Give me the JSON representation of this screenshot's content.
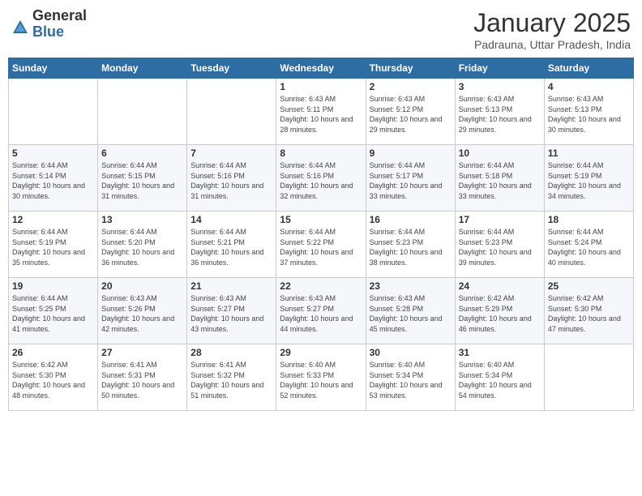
{
  "logo": {
    "general": "General",
    "blue": "Blue"
  },
  "header": {
    "month": "January 2025",
    "location": "Padrauna, Uttar Pradesh, India"
  },
  "days_of_week": [
    "Sunday",
    "Monday",
    "Tuesday",
    "Wednesday",
    "Thursday",
    "Friday",
    "Saturday"
  ],
  "weeks": [
    [
      {
        "day": "",
        "info": ""
      },
      {
        "day": "",
        "info": ""
      },
      {
        "day": "",
        "info": ""
      },
      {
        "day": "1",
        "info": "Sunrise: 6:43 AM\nSunset: 5:11 PM\nDaylight: 10 hours and 28 minutes."
      },
      {
        "day": "2",
        "info": "Sunrise: 6:43 AM\nSunset: 5:12 PM\nDaylight: 10 hours and 29 minutes."
      },
      {
        "day": "3",
        "info": "Sunrise: 6:43 AM\nSunset: 5:13 PM\nDaylight: 10 hours and 29 minutes."
      },
      {
        "day": "4",
        "info": "Sunrise: 6:43 AM\nSunset: 5:13 PM\nDaylight: 10 hours and 30 minutes."
      }
    ],
    [
      {
        "day": "5",
        "info": "Sunrise: 6:44 AM\nSunset: 5:14 PM\nDaylight: 10 hours and 30 minutes."
      },
      {
        "day": "6",
        "info": "Sunrise: 6:44 AM\nSunset: 5:15 PM\nDaylight: 10 hours and 31 minutes."
      },
      {
        "day": "7",
        "info": "Sunrise: 6:44 AM\nSunset: 5:16 PM\nDaylight: 10 hours and 31 minutes."
      },
      {
        "day": "8",
        "info": "Sunrise: 6:44 AM\nSunset: 5:16 PM\nDaylight: 10 hours and 32 minutes."
      },
      {
        "day": "9",
        "info": "Sunrise: 6:44 AM\nSunset: 5:17 PM\nDaylight: 10 hours and 33 minutes."
      },
      {
        "day": "10",
        "info": "Sunrise: 6:44 AM\nSunset: 5:18 PM\nDaylight: 10 hours and 33 minutes."
      },
      {
        "day": "11",
        "info": "Sunrise: 6:44 AM\nSunset: 5:19 PM\nDaylight: 10 hours and 34 minutes."
      }
    ],
    [
      {
        "day": "12",
        "info": "Sunrise: 6:44 AM\nSunset: 5:19 PM\nDaylight: 10 hours and 35 minutes."
      },
      {
        "day": "13",
        "info": "Sunrise: 6:44 AM\nSunset: 5:20 PM\nDaylight: 10 hours and 36 minutes."
      },
      {
        "day": "14",
        "info": "Sunrise: 6:44 AM\nSunset: 5:21 PM\nDaylight: 10 hours and 36 minutes."
      },
      {
        "day": "15",
        "info": "Sunrise: 6:44 AM\nSunset: 5:22 PM\nDaylight: 10 hours and 37 minutes."
      },
      {
        "day": "16",
        "info": "Sunrise: 6:44 AM\nSunset: 5:23 PM\nDaylight: 10 hours and 38 minutes."
      },
      {
        "day": "17",
        "info": "Sunrise: 6:44 AM\nSunset: 5:23 PM\nDaylight: 10 hours and 39 minutes."
      },
      {
        "day": "18",
        "info": "Sunrise: 6:44 AM\nSunset: 5:24 PM\nDaylight: 10 hours and 40 minutes."
      }
    ],
    [
      {
        "day": "19",
        "info": "Sunrise: 6:44 AM\nSunset: 5:25 PM\nDaylight: 10 hours and 41 minutes."
      },
      {
        "day": "20",
        "info": "Sunrise: 6:43 AM\nSunset: 5:26 PM\nDaylight: 10 hours and 42 minutes."
      },
      {
        "day": "21",
        "info": "Sunrise: 6:43 AM\nSunset: 5:27 PM\nDaylight: 10 hours and 43 minutes."
      },
      {
        "day": "22",
        "info": "Sunrise: 6:43 AM\nSunset: 5:27 PM\nDaylight: 10 hours and 44 minutes."
      },
      {
        "day": "23",
        "info": "Sunrise: 6:43 AM\nSunset: 5:28 PM\nDaylight: 10 hours and 45 minutes."
      },
      {
        "day": "24",
        "info": "Sunrise: 6:42 AM\nSunset: 5:29 PM\nDaylight: 10 hours and 46 minutes."
      },
      {
        "day": "25",
        "info": "Sunrise: 6:42 AM\nSunset: 5:30 PM\nDaylight: 10 hours and 47 minutes."
      }
    ],
    [
      {
        "day": "26",
        "info": "Sunrise: 6:42 AM\nSunset: 5:30 PM\nDaylight: 10 hours and 48 minutes."
      },
      {
        "day": "27",
        "info": "Sunrise: 6:41 AM\nSunset: 5:31 PM\nDaylight: 10 hours and 50 minutes."
      },
      {
        "day": "28",
        "info": "Sunrise: 6:41 AM\nSunset: 5:32 PM\nDaylight: 10 hours and 51 minutes."
      },
      {
        "day": "29",
        "info": "Sunrise: 6:40 AM\nSunset: 5:33 PM\nDaylight: 10 hours and 52 minutes."
      },
      {
        "day": "30",
        "info": "Sunrise: 6:40 AM\nSunset: 5:34 PM\nDaylight: 10 hours and 53 minutes."
      },
      {
        "day": "31",
        "info": "Sunrise: 6:40 AM\nSunset: 5:34 PM\nDaylight: 10 hours and 54 minutes."
      },
      {
        "day": "",
        "info": ""
      }
    ]
  ]
}
